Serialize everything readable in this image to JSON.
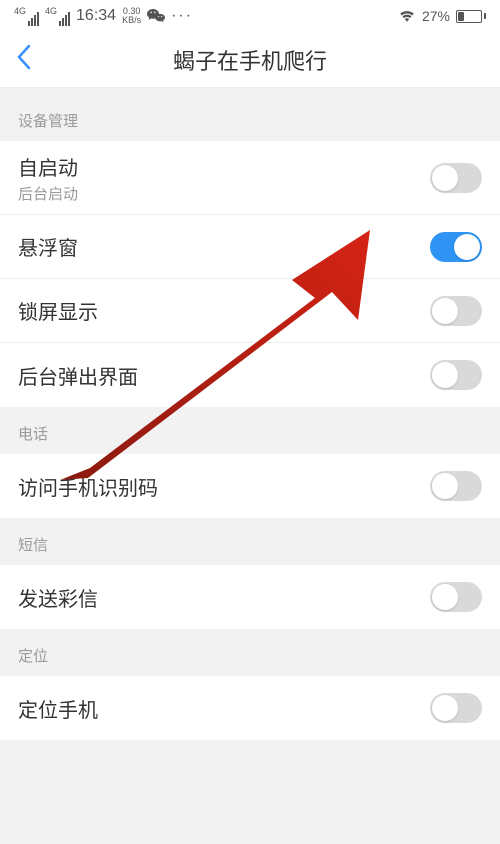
{
  "status": {
    "net_label_1": "4G",
    "net_label_2": "4G",
    "time": "16:34",
    "speed_value": "0.30",
    "speed_unit": "KB/s",
    "battery_percent": "27%"
  },
  "nav": {
    "title": "蝎子在手机爬行"
  },
  "sections": [
    {
      "header": "设备管理",
      "rows": [
        {
          "title": "自启动",
          "sub": "后台启动",
          "on": false
        },
        {
          "title": "悬浮窗",
          "sub": "",
          "on": true
        },
        {
          "title": "锁屏显示",
          "sub": "",
          "on": false
        },
        {
          "title": "后台弹出界面",
          "sub": "",
          "on": false
        }
      ]
    },
    {
      "header": "电话",
      "rows": [
        {
          "title": "访问手机识别码",
          "sub": "",
          "on": false
        }
      ]
    },
    {
      "header": "短信",
      "rows": [
        {
          "title": "发送彩信",
          "sub": "",
          "on": false
        }
      ]
    },
    {
      "header": "定位",
      "rows": [
        {
          "title": "定位手机",
          "sub": "",
          "on": false
        }
      ]
    }
  ]
}
